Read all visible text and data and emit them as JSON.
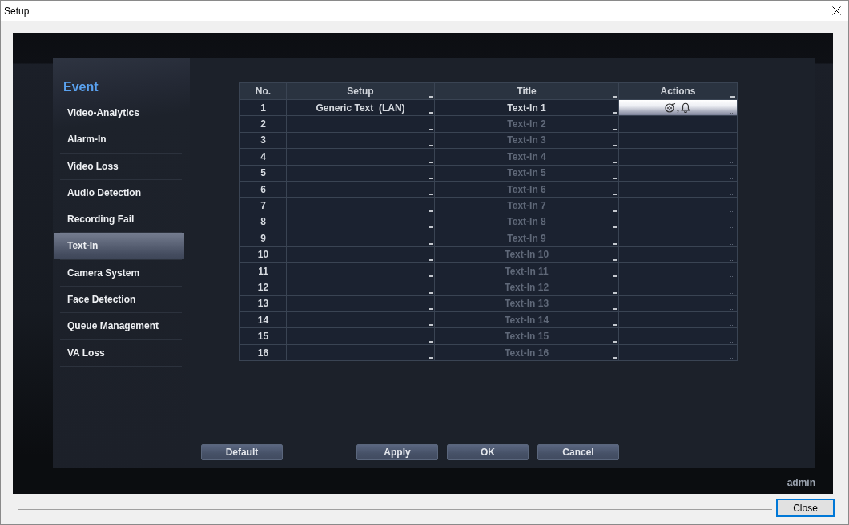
{
  "window": {
    "title": "Setup"
  },
  "sidebar": {
    "heading": "Event",
    "items": [
      {
        "label": "Video-Analytics",
        "selected": false
      },
      {
        "label": "Alarm-In",
        "selected": false
      },
      {
        "label": "Video Loss",
        "selected": false
      },
      {
        "label": "Audio Detection",
        "selected": false
      },
      {
        "label": "Recording Fail",
        "selected": false
      },
      {
        "label": "Text-In",
        "selected": true
      },
      {
        "label": "Camera System",
        "selected": false
      },
      {
        "label": "Face Detection",
        "selected": false
      },
      {
        "label": "Queue Management",
        "selected": false
      },
      {
        "label": "VA Loss",
        "selected": false
      }
    ]
  },
  "table": {
    "columns": [
      "No.",
      "Setup",
      "Title",
      "Actions"
    ],
    "rows": [
      {
        "no": "1",
        "setup": "Generic Text  (LAN)",
        "title": "Text-In 1",
        "disabled": false,
        "actions_set": true,
        "actions_separator": ","
      },
      {
        "no": "2",
        "title": "Text-In 2",
        "disabled": true,
        "actions_set": false
      },
      {
        "no": "3",
        "title": "Text-In 3",
        "disabled": true,
        "actions_set": false
      },
      {
        "no": "4",
        "title": "Text-In 4",
        "disabled": true,
        "actions_set": false
      },
      {
        "no": "5",
        "title": "Text-In 5",
        "disabled": true,
        "actions_set": false
      },
      {
        "no": "6",
        "title": "Text-In 6",
        "disabled": true,
        "actions_set": false
      },
      {
        "no": "7",
        "title": "Text-In 7",
        "disabled": true,
        "actions_set": false
      },
      {
        "no": "8",
        "title": "Text-In 8",
        "disabled": true,
        "actions_set": false
      },
      {
        "no": "9",
        "title": "Text-In 9",
        "disabled": true,
        "actions_set": false
      },
      {
        "no": "10",
        "title": "Text-In 10",
        "disabled": true,
        "actions_set": false
      },
      {
        "no": "11",
        "title": "Text-In 11",
        "disabled": true,
        "actions_set": false
      },
      {
        "no": "12",
        "title": "Text-In 12",
        "disabled": true,
        "actions_set": false
      },
      {
        "no": "13",
        "title": "Text-In 13",
        "disabled": true,
        "actions_set": false
      },
      {
        "no": "14",
        "title": "Text-In 14",
        "disabled": true,
        "actions_set": false
      },
      {
        "no": "15",
        "title": "Text-In 15",
        "disabled": true,
        "actions_set": false
      },
      {
        "no": "16",
        "title": "Text-In 16",
        "disabled": true,
        "actions_set": false
      }
    ]
  },
  "footer": {
    "left_buttons": [
      "Default"
    ],
    "right_buttons": [
      "Apply",
      "OK",
      "Cancel"
    ]
  },
  "user": "admin",
  "close_button": "Close"
}
